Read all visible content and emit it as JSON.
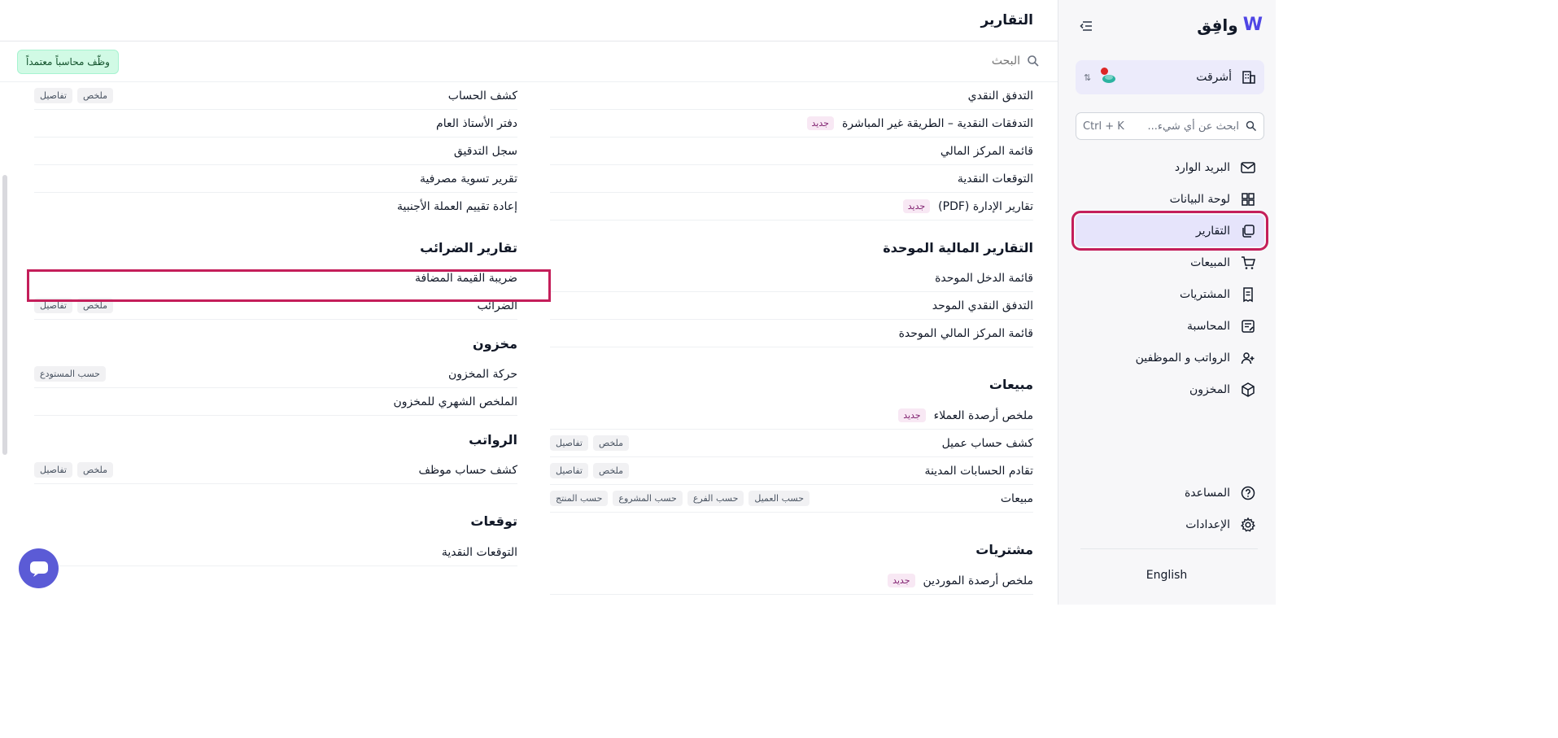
{
  "sidebar": {
    "logo_text": "وافِق",
    "company_name": "أشرقت",
    "search_placeholder": "ابحث عن أي شيء...",
    "search_shortcut": "Ctrl + K",
    "nav": [
      {
        "label": "البريد الوارد",
        "icon": "inbox-icon"
      },
      {
        "label": "لوحة البيانات",
        "icon": "dashboard-icon"
      },
      {
        "label": "التقارير",
        "icon": "reports-icon",
        "active": true
      },
      {
        "label": "المبيعات",
        "icon": "cart-icon"
      },
      {
        "label": "المشتريات",
        "icon": "receipt-icon"
      },
      {
        "label": "المحاسبة",
        "icon": "ledger-icon"
      },
      {
        "label": "الرواتب و الموظفين",
        "icon": "users-icon"
      },
      {
        "label": "المخزون",
        "icon": "box-icon"
      }
    ],
    "help_label": "المساعدة",
    "settings_label": "الإعدادات",
    "language_label": "English"
  },
  "header": {
    "title": "التقارير",
    "search_placeholder": "البحث",
    "hire_button": "وظّف محاسباً معتمداً"
  },
  "tags": {
    "summary": "ملخص",
    "details": "تفاصيل",
    "by_warehouse": "حسب المستودع",
    "by_customer": "حسب العميل",
    "by_branch": "حسب الفرع",
    "by_project": "حسب المشروع",
    "by_product": "حسب المنتج",
    "new": "جديد"
  },
  "right_column": {
    "financial": [
      "التدفق النقدي",
      "التدفقات النقدية – الطريقة غير المباشرة",
      "قائمة المركز المالي",
      "التوقعات النقدية",
      "تقارير الإدارة (PDF)"
    ],
    "consolidated_title": "التقارير المالية الموحدة",
    "consolidated": [
      "قائمة الدخل الموحدة",
      "التدفق النقدي الموحد",
      "قائمة المركز المالي الموحدة"
    ],
    "sales_title": "مبيعات",
    "sales": [
      "ملخص أرصدة العملاء",
      "كشف حساب عميل",
      "تقادم الحسابات المدينة",
      "مبيعات"
    ],
    "purchases_title": "مشتريات",
    "purchases": [
      "ملخص أرصدة الموردين"
    ]
  },
  "left_column": {
    "accounting": [
      "كشف الحساب",
      "دفتر الأستاذ العام",
      "سجل التدقيق",
      "تقرير تسوية مصرفية",
      "إعادة تقييم العملة الأجنبية"
    ],
    "tax_title": "تقارير الضرائب",
    "tax": [
      "ضريبة القيمة المضافة",
      "الضرائب"
    ],
    "inventory_title": "مخزون",
    "inventory": [
      "حركة المخزون",
      "الملخص الشهري للمخزون"
    ],
    "payroll_title": "الرواتب",
    "payroll": [
      "كشف حساب موظف"
    ],
    "forecasts_title": "توقعات",
    "forecasts": [
      "التوقعات النقدية"
    ]
  },
  "colors": {
    "accent": "#4f46e5",
    "highlight": "#c41e5a",
    "active_bg": "#e6e4fb",
    "hire_bg": "#d1fae5",
    "chat": "#5b5bd6"
  }
}
